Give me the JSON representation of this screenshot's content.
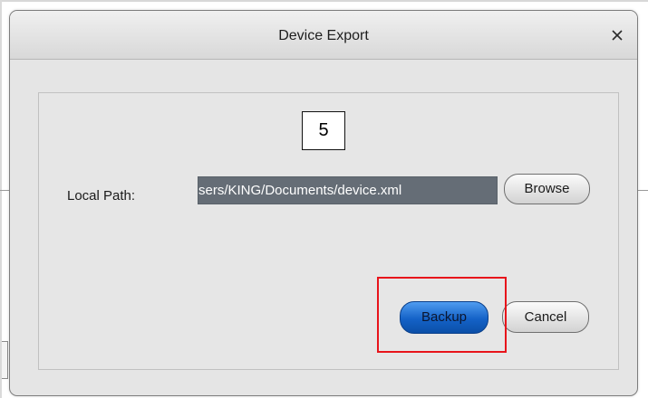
{
  "dialog": {
    "title": "Device Export",
    "close_icon": "close-icon"
  },
  "annotation": {
    "step_number": "5"
  },
  "form": {
    "local_path_label": "Local Path:",
    "local_path_value": "sers/KING/Documents/device.xml",
    "browse_label": "Browse"
  },
  "actions": {
    "backup_label": "Backup",
    "cancel_label": "Cancel"
  },
  "colors": {
    "primary_button": "#1462c7",
    "highlight_border": "#e8141b",
    "dialog_background": "#e5e5e5"
  }
}
